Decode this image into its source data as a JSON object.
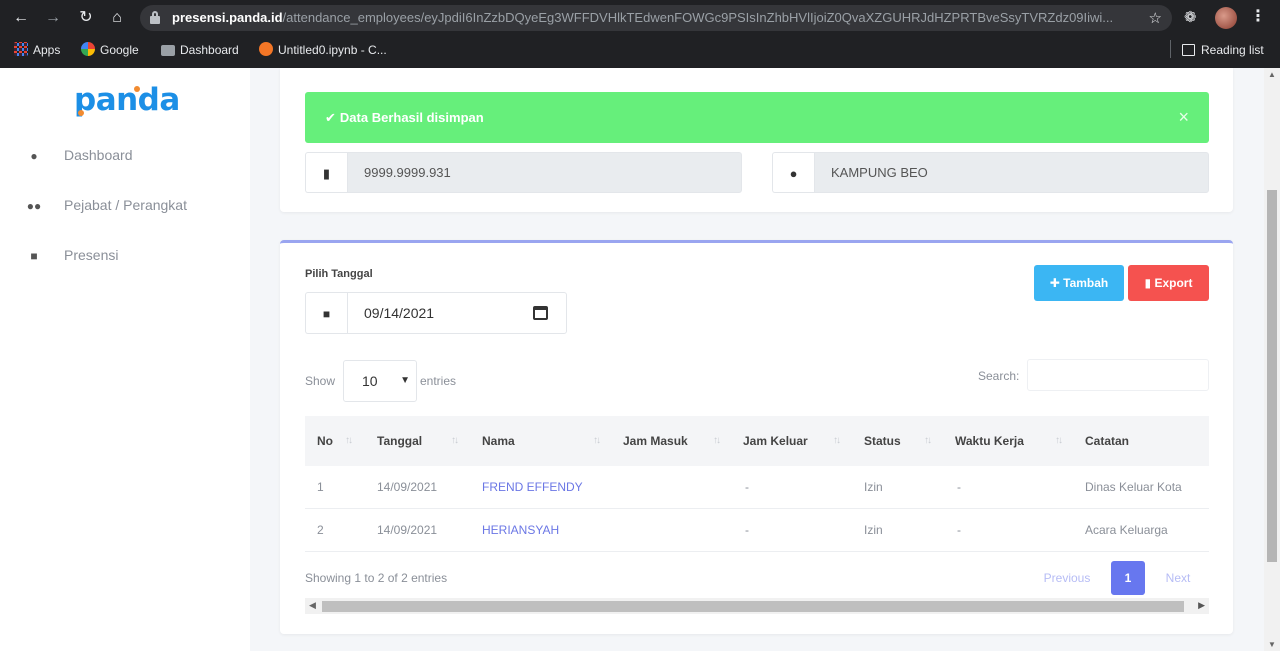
{
  "browser": {
    "url_host": "presensi.panda.id",
    "url_path": "/attendance_employees/eyJpdiI6InZzbDQyeEg3WFFDVHlkTEdwenFOWGc9PSIsInZhbHVlIjoiZ0QvaXZGUHRJdHZPRTBveSsyTVRZdz09Iiwi...",
    "bookmarks": [
      {
        "label": "Apps",
        "icon": "apps-grid-icon"
      },
      {
        "label": "Google",
        "icon": "google-icon"
      },
      {
        "label": "Dashboard",
        "icon": "folder-icon"
      },
      {
        "label": "Untitled0.ipynb - C...",
        "icon": "jupyter-icon"
      }
    ],
    "reading_list": "Reading list"
  },
  "sidebar": {
    "logo": "panda",
    "items": [
      {
        "label": "Dashboard",
        "icon": "fire-icon"
      },
      {
        "label": "Pejabat / Perangkat",
        "icon": "users-icon"
      },
      {
        "label": "Presensi",
        "icon": "clipboard-icon"
      }
    ]
  },
  "alert": {
    "message": "Data Berhasil disimpan",
    "close": "×",
    "color": "#66ef7b"
  },
  "info_fields": {
    "id_number": "9999.9999.931",
    "village": "KAMPUNG BEO"
  },
  "filter": {
    "label": "Pilih Tanggal",
    "date": "09/14/2021"
  },
  "buttons": {
    "add": "Tambah",
    "export": "Export",
    "add_color": "#3bb6f3",
    "export_color": "#f5524f"
  },
  "table_controls": {
    "show": "Show",
    "page_size": "10",
    "entries": "entries",
    "search": "Search:"
  },
  "table": {
    "columns": [
      "No",
      "Tanggal",
      "Nama",
      "Jam Masuk",
      "Jam Keluar",
      "Status",
      "Waktu Kerja",
      "Catatan"
    ],
    "rows": [
      {
        "no": "1",
        "tanggal": "14/09/2021",
        "nama": "FREND EFFENDY",
        "jam_masuk": "",
        "jam_keluar": "-",
        "status": "Izin",
        "waktu_kerja": "-",
        "catatan": "Dinas Keluar Kota"
      },
      {
        "no": "2",
        "tanggal": "14/09/2021",
        "nama": "HERIANSYAH",
        "jam_masuk": "",
        "jam_keluar": "-",
        "status": "Izin",
        "waktu_kerja": "-",
        "catatan": "Acara Keluarga"
      }
    ]
  },
  "pagination": {
    "info": "Showing 1 to 2 of 2 entries",
    "previous": "Previous",
    "current": "1",
    "next": "Next"
  }
}
